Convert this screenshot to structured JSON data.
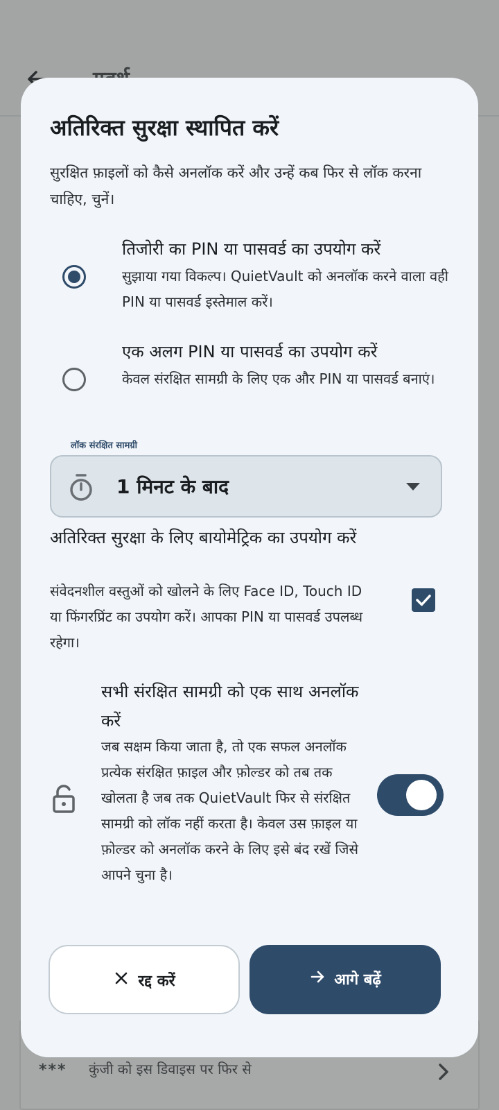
{
  "background": {
    "title": "गवर्थ",
    "card_text": "अपना तिजोरी का PIN या पासवर्ड अपडेट करें। आपकी तिजोरी की कुंजी को इस डिवाइस पर फिर से",
    "card_icon": "***"
  },
  "dialog": {
    "title": "अतिरिक्त सुरक्षा स्थापित करें",
    "description": "सुरक्षित फ़ाइलों को कैसे अनलॉक करें और उन्हें कब फिर से लॉक करना चाहिए, चुनें।",
    "options": [
      {
        "title": "तिजोरी का PIN या पासवर्ड का उपयोग करें",
        "description": "सुझाया गया विकल्प। QuietVault को अनलॉक करने वाला वही PIN या पासवर्ड इस्तेमाल करें।",
        "selected": true
      },
      {
        "title": "एक अलग PIN या पासवर्ड का उपयोग करें",
        "description": "केवल संरक्षित सामग्री के लिए एक और PIN या पासवर्ड बनाएं।",
        "selected": false
      }
    ],
    "lock_field": {
      "label": "लॉक संरक्षित सामग्री",
      "value": "1 मिनट के बाद",
      "icon": "timer-icon"
    },
    "biometric": {
      "title": "अतिरिक्त सुरक्षा के लिए बायोमेट्रिक का उपयोग करें",
      "description": "संवेदनशील वस्तुओं को खोलने के लिए Face ID, Touch ID या फिंगरप्रिंट का उपयोग करें। आपका PIN या पासवर्ड उपलब्ध रहेगा।",
      "checked": true
    },
    "unlock_all": {
      "title": "सभी संरक्षित सामग्री को एक साथ अनलॉक करें",
      "description": "जब सक्षम किया जाता है, तो एक सफल अनलॉक प्रत्येक संरक्षित फ़ाइल और फ़ोल्डर को तब तक खोलता है जब तक QuietVault फिर से संरक्षित सामग्री को लॉक नहीं करता है। केवल उस फ़ाइल या फ़ोल्डर को अनलॉक करने के लिए इसे बंद रखें जिसे आपने चुना है।",
      "enabled": true,
      "icon": "lock-open-icon"
    },
    "buttons": {
      "cancel": "रद्द करें",
      "next": "आगे बढ़ें"
    }
  },
  "colors": {
    "accent": "#2f4b6a",
    "dialog_bg": "#f2f6fa",
    "scrim": "#a3a5a5"
  }
}
